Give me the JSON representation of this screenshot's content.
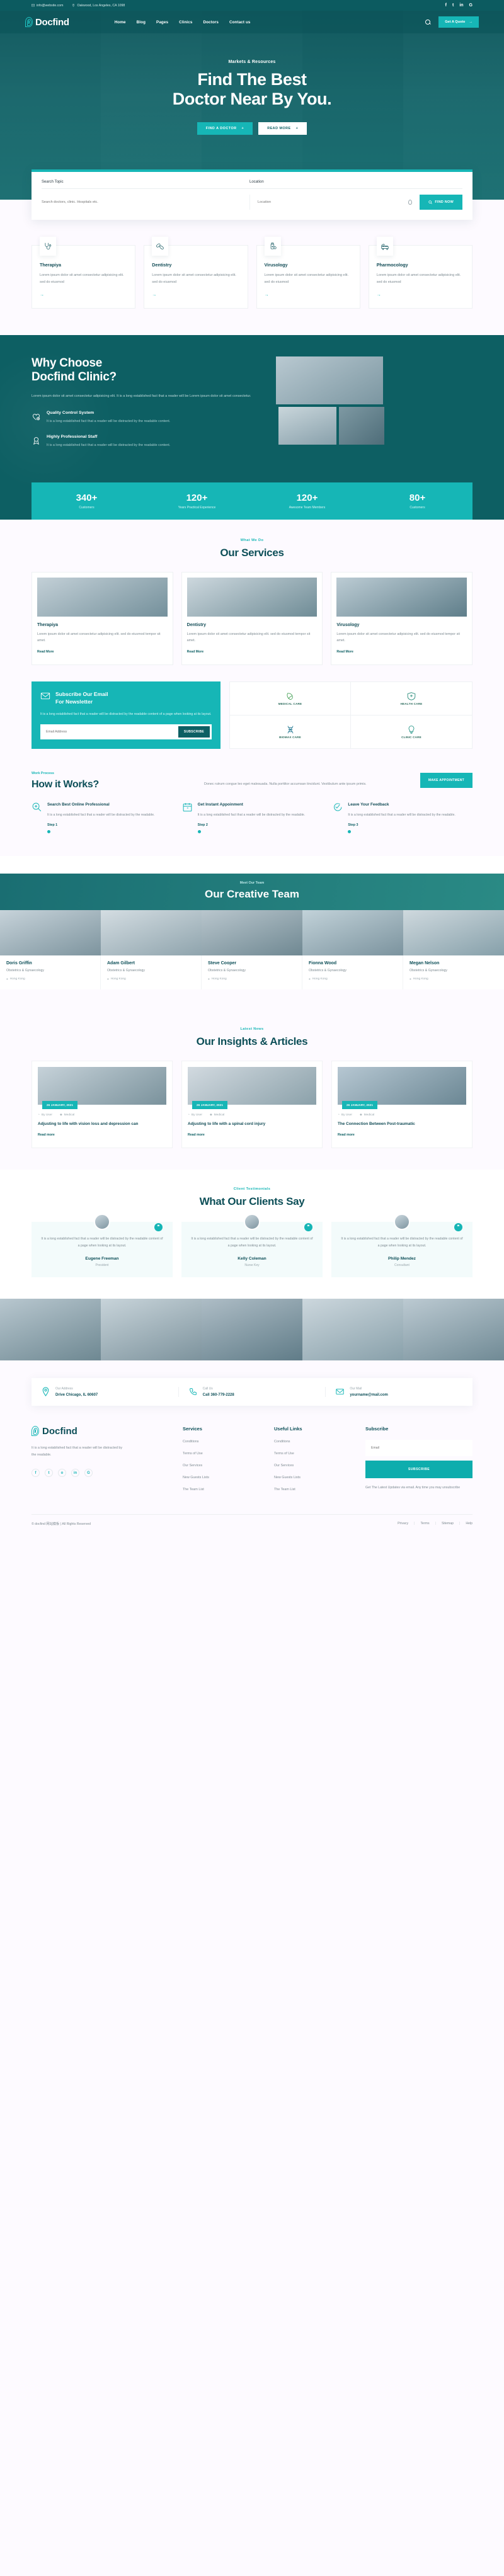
{
  "topbar": {
    "email": "info@website.com",
    "address": "Oakwood, Los Angeles, CA 1098",
    "social": [
      "f",
      "t",
      "in",
      "G"
    ]
  },
  "nav": {
    "brand": "Docfind",
    "links": [
      "Home",
      "Blog",
      "Pages",
      "Clinics",
      "Doctors",
      "Contact us"
    ],
    "quote_button": "Get A Quote"
  },
  "hero": {
    "kicker": "Markets & Resources",
    "title_line1": "Find The Best",
    "title_line2": "Doctor Near By You.",
    "btn_primary": "FIND A DOCTOR",
    "btn_secondary": "READ MORE"
  },
  "search": {
    "label_topic": "Search Topic",
    "label_location": "Location",
    "placeholder_topic": "Search doctors, clinic. Hospitals etc.",
    "placeholder_location": "Location",
    "button": "FIND NOW"
  },
  "specialties": [
    {
      "icon": "stethoscope-icon",
      "title": "Therapiya",
      "text": "Lorem ipsum dolor sit amet consectetur adipisicing elit. sed do eiusmod"
    },
    {
      "icon": "pills-icon",
      "title": "Dentistry",
      "text": "Lorem ipsum dolor sit amet consectetur adipisicing elit. sed do eiusmod"
    },
    {
      "icon": "vaccine-icon",
      "title": "Virusology",
      "text": "Lorem ipsum dolor sit amet consectetur adipisicing elit. sed do eiusmod"
    },
    {
      "icon": "hospital-bed-icon",
      "title": "Pharmocology",
      "text": "Lorem ipsum dolor sit amet consectetur adipisicing elit. sed do eiusmod"
    }
  ],
  "why": {
    "title_line1": "Why Choose",
    "title_line2": "Docfind Clinic?",
    "desc": "Lorem ipsum dolor sit amet consectetur adipisicing elit. It is a long established fact that a reader will be Lorem ipsum dolor sit amet consectetur.",
    "features": [
      {
        "icon": "heart-check-icon",
        "title": "Quality Control System",
        "text": "It is a long established fact that a reader will be distracted by the readable content."
      },
      {
        "icon": "badge-staff-icon",
        "title": "Highly Professional Staff",
        "text": "It is a long established fact that a reader will be distracted by the readable content."
      }
    ]
  },
  "stats": [
    {
      "value": "340+",
      "label": "Customers"
    },
    {
      "value": "120+",
      "label": "Years Practical Experience"
    },
    {
      "value": "120+",
      "label": "Awesome Team Members"
    },
    {
      "value": "80+",
      "label": "Customers"
    }
  ],
  "services": {
    "kicker": "What We Do",
    "title": "Our Services",
    "cards": [
      {
        "title": "Therapiya",
        "text": "Lorem ipsum dolor sit amet consectetur adipisicing elit. sed do eiusmod tempor sit amet.",
        "link": "Read More"
      },
      {
        "title": "Dentistry",
        "text": "Lorem ipsum dolor sit amet consectetur adipisicing elit. sed do eiusmod tempor sit amet.",
        "link": "Read More"
      },
      {
        "title": "Virusology",
        "text": "Lorem ipsum dolor sit amet consectetur adipisicing elit. sed do eiusmod tempor sit amet.",
        "link": "Read More"
      }
    ]
  },
  "newsletter": {
    "title_line1": "Subscribe Our Email",
    "title_line2": "For Newsletter",
    "text": "It is a long established fact that a reader will be distracted by the readable content of a page when looking at its layout.",
    "placeholder": "Email Address",
    "button": "SUBSCRIBE",
    "icon": "envelope-icon"
  },
  "partners": [
    {
      "icon": "leaf-health-icon",
      "name": "MEDICAL CARE"
    },
    {
      "icon": "shield-health-icon",
      "name": "HEALTH CARE"
    },
    {
      "icon": "dna-icon",
      "name": "BIOMAX CARE"
    },
    {
      "icon": "bulb-care-icon",
      "name": "CLINIC CARE"
    }
  ],
  "how": {
    "kicker": "Work Process",
    "title": "How it Works?",
    "desc": "Donec rutrum congue leo eget malesuada. Nulla porttitor accumsan tincidunt. Vestibulum ante ipsum primis.",
    "button": "MAKE APPOINTMENT",
    "steps": [
      {
        "icon": "search-doc-icon",
        "title": "Search Best Online Professional",
        "text": "It is a long established fact that a reader will be distracted by the readable.",
        "label": "Step 1"
      },
      {
        "icon": "calendar-icon",
        "title": "Get Instant Appoinment",
        "text": "It is a long established fact that a reader will be distracted by the readable.",
        "label": "Step 2"
      },
      {
        "icon": "feedback-icon",
        "title": "Leave Your Feedback",
        "text": "It is a long established fact that a reader will be distracted by the readable.",
        "label": "Step 3"
      }
    ]
  },
  "team": {
    "kicker": "Meet Our Team",
    "title": "Our Creative Team",
    "members": [
      {
        "name": "Doris Griffin",
        "role": "Obstetrics & Gynaecology",
        "location": "Hong Kong"
      },
      {
        "name": "Adam Gilbert",
        "role": "Obstetrics & Gynaecology",
        "location": "Hong Kong"
      },
      {
        "name": "Steve Cooper",
        "role": "Obstetrics & Gynaecology",
        "location": "Hong Kong"
      },
      {
        "name": "Fionna Wood",
        "role": "Obstetrics & Gynaecology",
        "location": "Hong Kong"
      },
      {
        "name": "Megan Nelson",
        "role": "Obstetrics & Gynaecology",
        "location": "Hong Kong"
      }
    ]
  },
  "blog": {
    "kicker": "Latest News",
    "title": "Our Insights & Articles",
    "posts": [
      {
        "date": "26 JANUARY, 2021",
        "author": "By User",
        "category": "Medical",
        "title": "Adjusting to life with vision loss and depression can",
        "link": "Read more"
      },
      {
        "date": "26 JANUARY, 2021",
        "author": "By User",
        "category": "Medical",
        "title": "Adjusting to life with a spinal cord injury",
        "link": "Read more"
      },
      {
        "date": "26 JANUARY, 2021",
        "author": "By User",
        "category": "Medical",
        "title": "The Connection Between Post-traumatic",
        "link": "Read more"
      }
    ]
  },
  "testimonials": {
    "kicker": "Client Testimonials",
    "title": "What Our Clients Say",
    "items": [
      {
        "text": "It is a long established fact that a reader will be distracted by the readable content of a page when looking at its layout.",
        "name": "Eugene Freeman",
        "role": "President"
      },
      {
        "text": "It is a long established fact that a reader will be distracted by the readable content of a page when looking at its layout.",
        "name": "Kelly Coleman",
        "role": "Nurse Key"
      },
      {
        "text": "It is a long established fact that a reader will be distracted by the readable content of a page when looking at its layout.",
        "name": "Philip Mendez",
        "role": "Consultant"
      }
    ]
  },
  "contact": [
    {
      "icon": "location-icon",
      "label": "Our Address",
      "value": "Drive Chicago, IL 60607"
    },
    {
      "icon": "phone-icon",
      "label": "Call Us",
      "value": "Call 360-779-2228"
    },
    {
      "icon": "mail-icon",
      "label": "Our Mail",
      "value": "yourname@mail.com"
    }
  ],
  "footer": {
    "brand": "Docfind",
    "about": "It is a long established fact that a reader will be distracted by the readable.",
    "social": [
      "f",
      "t",
      "o",
      "in",
      "G"
    ],
    "services_title": "Services",
    "services_links": [
      "Conditions",
      "Terms of Use",
      "Our Services",
      "New Guests Lists",
      "The Team List"
    ],
    "useful_title": "Useful Links",
    "useful_links": [
      "Conditions",
      "Terms of Use",
      "Our Services",
      "New Guests Lists",
      "The Team List"
    ],
    "subscribe_title": "Subscribe",
    "subscribe_placeholder": "Email",
    "subscribe_button": "SUBSCRIBE",
    "subscribe_note": "Get The Latest Updates via email. Any time you may unsubscribe",
    "copyright": "© docfind 网站模板 | All Rights Reserved",
    "bottom_links": [
      "Privacy",
      "Terms",
      "Sitemap",
      "Help"
    ]
  },
  "colors": {
    "teal": "#16b6b6",
    "dark_teal": "#0d5f63",
    "heading": "#0d4f58"
  }
}
